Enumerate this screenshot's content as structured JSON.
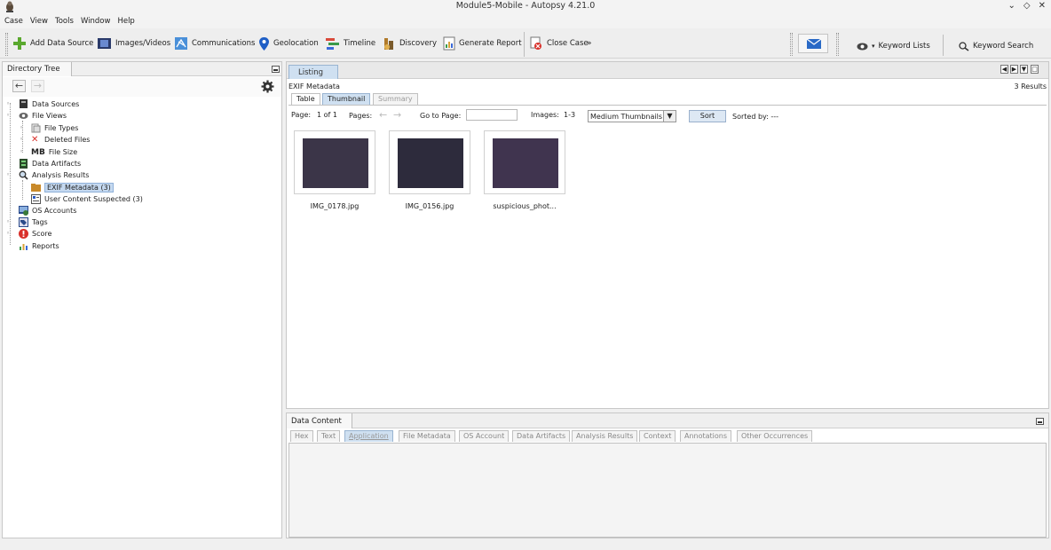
{
  "window": {
    "title": "Module5-Mobile - Autopsy 4.21.0"
  },
  "menu": [
    "Case",
    "View",
    "Tools",
    "Window",
    "Help"
  ],
  "toolbar": {
    "add_data_source": "Add Data Source",
    "images_videos": "Images/Videos",
    "communications": "Communications",
    "geolocation": "Geolocation",
    "timeline": "Timeline",
    "discovery": "Discovery",
    "generate_report": "Generate Report",
    "close_case": "Close Case",
    "keyword_lists": "Keyword Lists",
    "keyword_search": "Keyword Search"
  },
  "directory_tree": {
    "tab": "Directory Tree",
    "items": {
      "data_sources": "Data Sources",
      "file_views": "File Views",
      "file_types": "File Types",
      "deleted_files": "Deleted Files",
      "file_size_prefix": "MB",
      "file_size": "File Size",
      "data_artifacts": "Data Artifacts",
      "analysis_results": "Analysis Results",
      "exif_metadata": "EXIF Metadata (3)",
      "user_content_suspected": "User Content Suspected (3)",
      "os_accounts": "OS Accounts",
      "tags": "Tags",
      "score": "Score",
      "reports": "Reports"
    }
  },
  "listing": {
    "tab": "Listing",
    "heading": "EXIF Metadata",
    "results": "3 Results",
    "subtabs": {
      "table": "Table",
      "thumbnail": "Thumbnail",
      "summary": "Summary"
    },
    "page_label": "Page:",
    "page_value": "1 of 1",
    "pages_label": "Pages:",
    "goto_label": "Go to Page:",
    "goto_value": "",
    "images_label": "Images:",
    "images_value": "1-3",
    "thumb_size": "Medium Thumbnails",
    "sort": "Sort",
    "sorted_by": "Sorted by: ---",
    "thumbnails": [
      {
        "name": "IMG_0178.jpg",
        "color": "#3b3548"
      },
      {
        "name": "IMG_0156.jpg",
        "color": "#2d2b3c"
      },
      {
        "name": "suspicious_phot...",
        "color": "#40344f"
      }
    ]
  },
  "data_content": {
    "tab": "Data Content",
    "tabs": [
      "Hex",
      "Text",
      "Application",
      "File Metadata",
      "OS Account",
      "Data Artifacts",
      "Analysis Results",
      "Context",
      "Annotations",
      "Other Occurrences"
    ]
  }
}
